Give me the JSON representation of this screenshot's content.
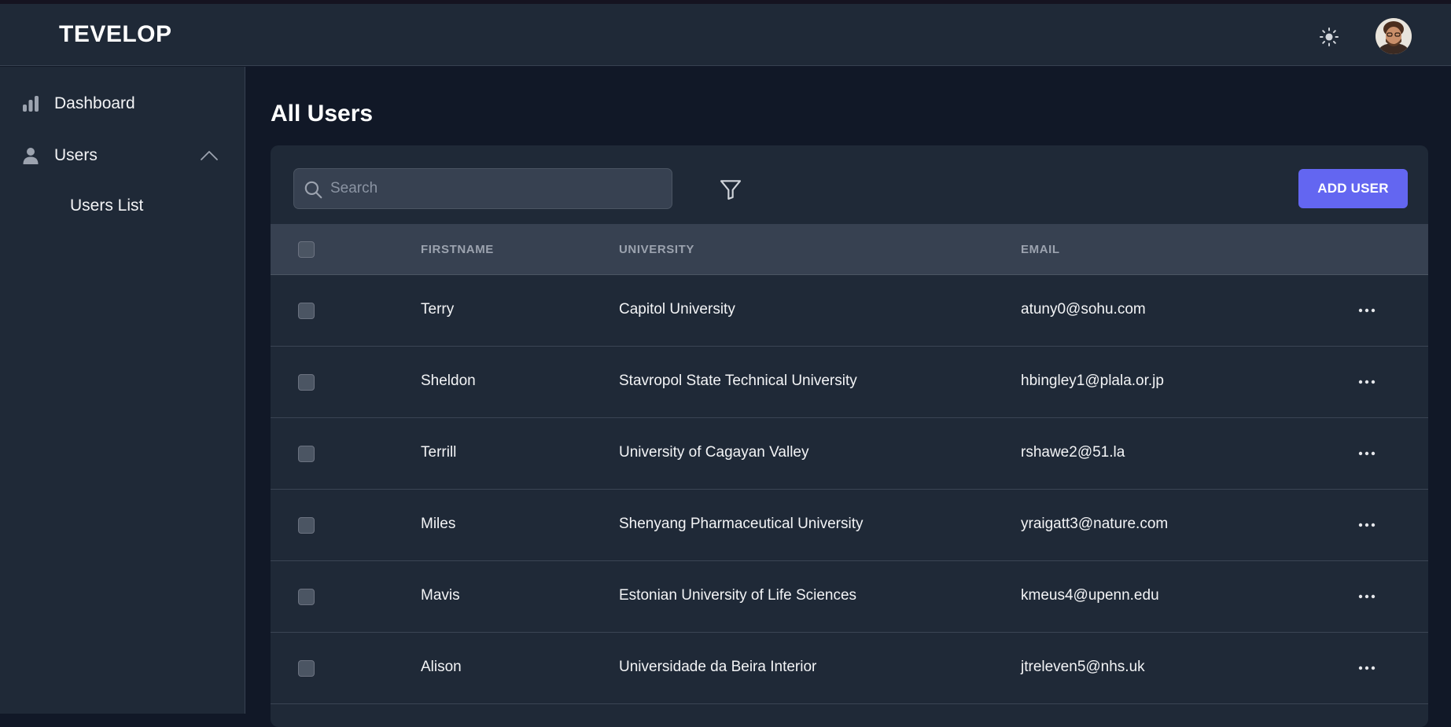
{
  "app": {
    "brand": "TEVELOP"
  },
  "header": {
    "theme_icon": "sun-icon",
    "avatar_icon": "user-avatar"
  },
  "sidebar": {
    "items": [
      {
        "label": "Dashboard",
        "icon": "bar-chart-icon"
      },
      {
        "label": "Users",
        "icon": "user-icon",
        "expanded": true,
        "children": [
          {
            "label": "Users List"
          }
        ]
      }
    ]
  },
  "main": {
    "title": "All Users",
    "search": {
      "placeholder": "Search",
      "value": ""
    },
    "add_user_label": "ADD USER",
    "table": {
      "columns": [
        "FIRSTNAME",
        "UNIVERSITY",
        "EMAIL"
      ],
      "rows": [
        {
          "firstname": "Terry",
          "university": "Capitol University",
          "email": "atuny0@sohu.com"
        },
        {
          "firstname": "Sheldon",
          "university": "Stavropol State Technical University",
          "email": "hbingley1@plala.or.jp"
        },
        {
          "firstname": "Terrill",
          "university": "University of Cagayan Valley",
          "email": "rshawe2@51.la"
        },
        {
          "firstname": "Miles",
          "university": "Shenyang Pharmaceutical University",
          "email": "yraigatt3@nature.com"
        },
        {
          "firstname": "Mavis",
          "university": "Estonian University of Life Sciences",
          "email": "kmeus4@upenn.edu"
        },
        {
          "firstname": "Alison",
          "university": "Universidade da Beira Interior",
          "email": "jtreleven5@nhs.uk"
        }
      ]
    }
  },
  "colors": {
    "accent": "#6366f1",
    "background": "#111827",
    "surface": "#1f2937",
    "header_row": "#374151"
  }
}
